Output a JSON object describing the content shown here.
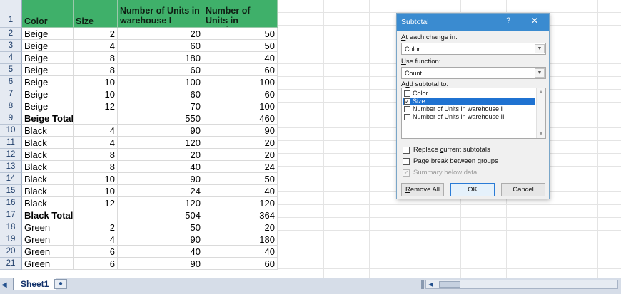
{
  "sheet": {
    "header": {
      "row_num": "1",
      "color": "Color",
      "size": "Size",
      "units1": "Number of Units in warehouse I",
      "units2": "Number of Units in warehouse II"
    },
    "rows": [
      {
        "n": "2",
        "color": "Beige",
        "size": "2",
        "u1": "20",
        "u2": "50"
      },
      {
        "n": "3",
        "color": "Beige",
        "size": "4",
        "u1": "60",
        "u2": "50"
      },
      {
        "n": "4",
        "color": "Beige",
        "size": "8",
        "u1": "180",
        "u2": "40"
      },
      {
        "n": "5",
        "color": "Beige",
        "size": "8",
        "u1": "60",
        "u2": "60"
      },
      {
        "n": "6",
        "color": "Beige",
        "size": "10",
        "u1": "100",
        "u2": "100"
      },
      {
        "n": "7",
        "color": "Beige",
        "size": "10",
        "u1": "60",
        "u2": "60"
      },
      {
        "n": "8",
        "color": "Beige",
        "size": "12",
        "u1": "70",
        "u2": "100"
      },
      {
        "n": "9",
        "color": "Beige Total",
        "size": "",
        "u1": "550",
        "u2": "460"
      },
      {
        "n": "10",
        "color": "Black",
        "size": "4",
        "u1": "90",
        "u2": "90"
      },
      {
        "n": "11",
        "color": "Black",
        "size": "4",
        "u1": "120",
        "u2": "20"
      },
      {
        "n": "12",
        "color": "Black",
        "size": "8",
        "u1": "20",
        "u2": "20"
      },
      {
        "n": "13",
        "color": "Black",
        "size": "8",
        "u1": "40",
        "u2": "24"
      },
      {
        "n": "14",
        "color": "Black",
        "size": "10",
        "u1": "90",
        "u2": "50"
      },
      {
        "n": "15",
        "color": "Black",
        "size": "10",
        "u1": "24",
        "u2": "40"
      },
      {
        "n": "16",
        "color": "Black",
        "size": "12",
        "u1": "120",
        "u2": "120"
      },
      {
        "n": "17",
        "color": "Black Total",
        "size": "",
        "u1": "504",
        "u2": "364"
      },
      {
        "n": "18",
        "color": "Green",
        "size": "2",
        "u1": "50",
        "u2": "20"
      },
      {
        "n": "19",
        "color": "Green",
        "size": "4",
        "u1": "90",
        "u2": "180"
      },
      {
        "n": "20",
        "color": "Green",
        "size": "6",
        "u1": "40",
        "u2": "40"
      },
      {
        "n": "21",
        "color": "Green",
        "size": "6",
        "u1": "90",
        "u2": "60"
      }
    ],
    "header_color": "#3fb06a"
  },
  "tabs": {
    "sheet1": "Sheet1"
  },
  "dialog": {
    "title": "Subtotal",
    "help": "?",
    "close": "✕",
    "change_label_pre": "",
    "change_label_u": "A",
    "change_label_post": "t each change in:",
    "change_value": "Color",
    "func_label_u": "U",
    "func_label_post": "se function:",
    "func_value": "Count",
    "add_label_pre": "A",
    "add_label_u": "d",
    "add_label_post": "d subtotal to:",
    "fields": [
      {
        "label": "Color",
        "checked": ""
      },
      {
        "label": "Size",
        "checked": "✓"
      },
      {
        "label": "Number of Units in warehouse I",
        "checked": ""
      },
      {
        "label": "Number of Units in warehouse II",
        "checked": ""
      }
    ],
    "replace_pre": "Replace ",
    "replace_u": "c",
    "replace_post": "urrent subtotals",
    "pagebreak_u": "P",
    "pagebreak_post": "age break between groups",
    "summary": "Summary below data",
    "summary_check": "✓",
    "remove_u": "R",
    "remove_post": "emove All",
    "ok": "OK",
    "cancel": "Cancel",
    "titlebar_color": "#3a8bd0"
  }
}
